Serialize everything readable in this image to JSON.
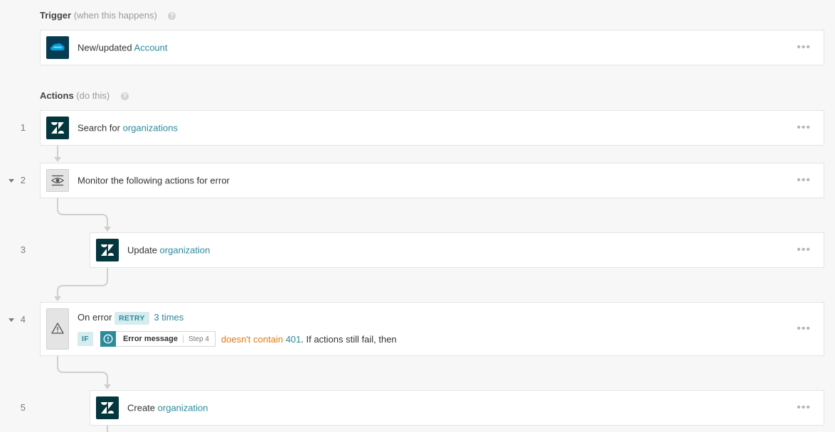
{
  "trigger_header": {
    "title": "Trigger",
    "subtitle": "(when this happens)",
    "help": "?"
  },
  "trigger": {
    "prefix": "New/updated",
    "object": "Account",
    "more": "•••"
  },
  "actions_header": {
    "title": "Actions",
    "subtitle": "(do this)",
    "help": "?"
  },
  "steps": [
    {
      "num": "1",
      "prefix": "Search for",
      "object": "organizations",
      "more": "•••"
    },
    {
      "num": "2",
      "text": "Monitor the following actions for error",
      "more": "•••"
    },
    {
      "num": "3",
      "prefix": "Update",
      "object": "organization",
      "more": "•••"
    },
    {
      "num": "4",
      "prefix": "On error",
      "badge": "RETRY",
      "times": "3 times",
      "if_label": "IF",
      "pill_label": "Error message",
      "pill_sub": "Step 4",
      "condition": "doesn't contain",
      "value": "401",
      "suffix": ". If actions still fail, then",
      "more": "•••"
    },
    {
      "num": "5",
      "prefix": "Create",
      "object": "organization",
      "more": "•••"
    }
  ],
  "colors": {
    "accent": "#2b8a9c",
    "orange": "#e07b16",
    "zendesk": "#03363d",
    "salesforce": "#00a1e0"
  }
}
